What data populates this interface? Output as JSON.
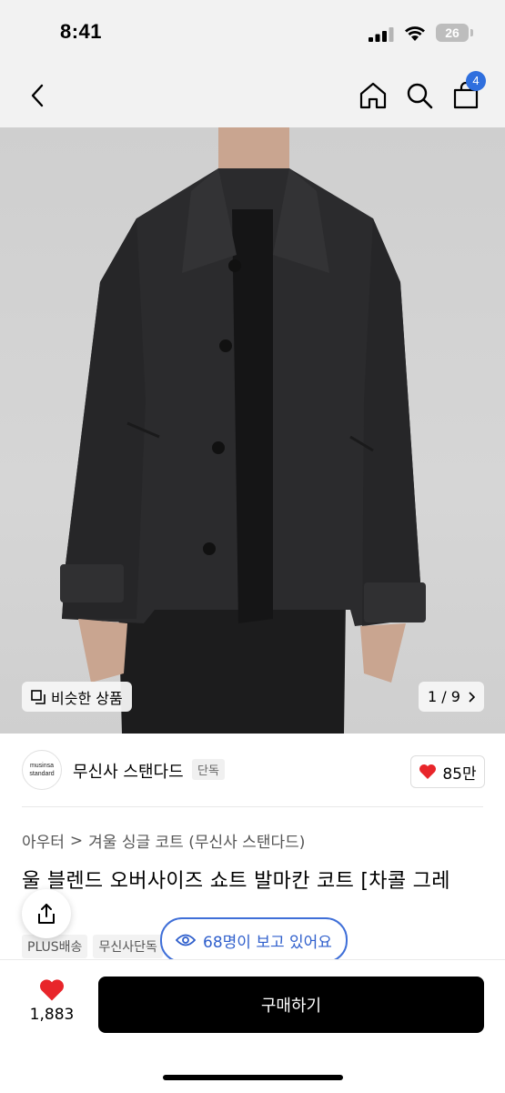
{
  "status": {
    "time": "8:41",
    "battery": "26"
  },
  "header": {
    "cart_count": "4"
  },
  "gallery": {
    "similar_label": "비슷한 상품",
    "counter": "1 / 9"
  },
  "brand": {
    "logo_line1": "musinsa",
    "logo_line2": "standard",
    "name": "무신사 스탠다드",
    "tag": "단독",
    "likes": "85만"
  },
  "breadcrumb": {
    "cat1": "아우터",
    "sep": ">",
    "cat2": "겨울 싱글 코트 (무신사 스탠다드)"
  },
  "product": {
    "title": "울 블렌드 오버사이즈 쇼트 발마칸 코트 [차콜 그레"
  },
  "tags": [
    "PLUS배송",
    "무신사단독"
  ],
  "viewers": {
    "label": "68명이 보고 있어요"
  },
  "bottom": {
    "wish_count": "1,883",
    "buy_label": "구매하기"
  },
  "colors": {
    "accent": "#2f6fde",
    "heart": "#e8252a",
    "buy_bg": "#000000"
  }
}
